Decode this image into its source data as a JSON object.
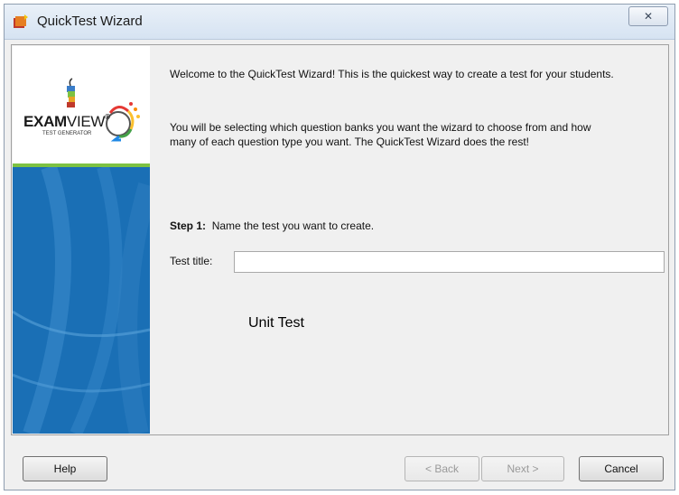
{
  "window": {
    "title": "QuickTest Wizard",
    "app_icon": "quicktest-app-icon",
    "close_icon": "close-icon"
  },
  "logo": {
    "name_bold": "EXAM",
    "name_light": "VIEW",
    "trademark": "®",
    "subtitle": "TEST GENERATOR"
  },
  "content": {
    "welcome": "Welcome to the QuickTest Wizard!  This is the quickest way to create a test for your students.",
    "description": "You will be selecting which question banks you want the wizard to choose from and how many of each question type you want.  The QuickTest Wizard does the rest!",
    "step_label": "Step 1:",
    "step_text": "Name the test you want to create.",
    "field_label": "Test title:",
    "field_value": "",
    "overlay_text": "Unit Test"
  },
  "buttons": {
    "help": "Help",
    "back": "< Back",
    "next": "Next >",
    "cancel": "Cancel"
  },
  "colors": {
    "side_blue": "#1a6fb5",
    "side_green": "#7dc242"
  }
}
